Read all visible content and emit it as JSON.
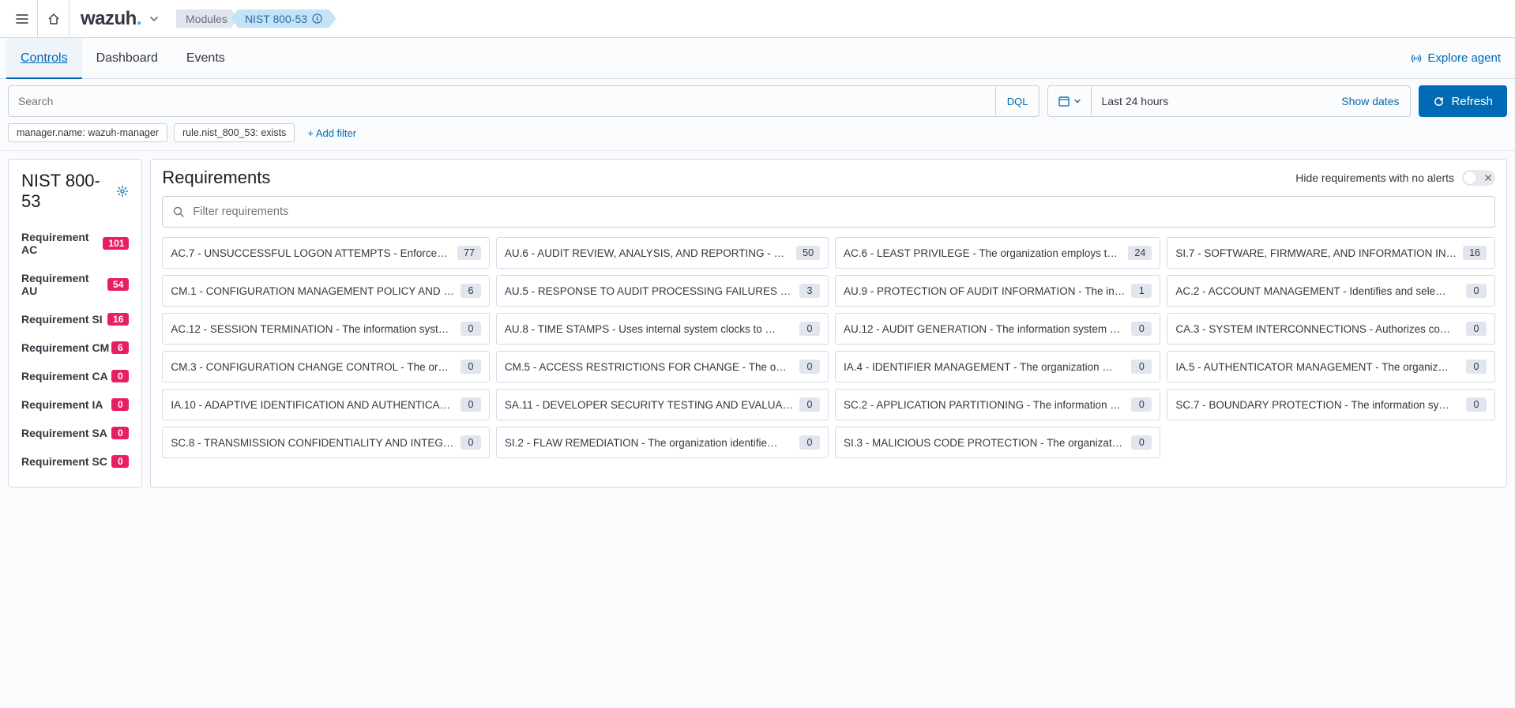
{
  "header": {
    "brand": "wazuh",
    "breadcrumb": {
      "modules": "Modules",
      "current": "NIST 800-53"
    }
  },
  "tabs": {
    "controls": "Controls",
    "dashboard": "Dashboard",
    "events": "Events",
    "explore": "Explore agent"
  },
  "search": {
    "placeholder": "Search",
    "dql": "DQL",
    "time": "Last 24 hours",
    "show_dates": "Show dates",
    "refresh": "Refresh"
  },
  "filters": {
    "f1": "manager.name: wazuh-manager",
    "f2": "rule.nist_800_53: exists",
    "add": "+ Add filter"
  },
  "sidebar": {
    "title": "NIST 800-53",
    "items": [
      {
        "label": "Requirement AC",
        "count": "101"
      },
      {
        "label": "Requirement AU",
        "count": "54"
      },
      {
        "label": "Requirement SI",
        "count": "16"
      },
      {
        "label": "Requirement CM",
        "count": "6"
      },
      {
        "label": "Requirement CA",
        "count": "0"
      },
      {
        "label": "Requirement IA",
        "count": "0"
      },
      {
        "label": "Requirement SA",
        "count": "0"
      },
      {
        "label": "Requirement SC",
        "count": "0"
      }
    ]
  },
  "requirements": {
    "title": "Requirements",
    "hide_label": "Hide requirements with no alerts",
    "filter_placeholder": "Filter requirements",
    "cards": [
      {
        "text": "AC.7 - UNSUCCESSFUL LOGON ATTEMPTS - Enforce…",
        "count": "77"
      },
      {
        "text": "AU.6 - AUDIT REVIEW, ANALYSIS, AND REPORTING - …",
        "count": "50"
      },
      {
        "text": "AC.6 - LEAST PRIVILEGE - The organization employs t…",
        "count": "24"
      },
      {
        "text": "SI.7 - SOFTWARE, FIRMWARE, AND INFORMATION IN…",
        "count": "16"
      },
      {
        "text": "CM.1 - CONFIGURATION MANAGEMENT POLICY AND …",
        "count": "6"
      },
      {
        "text": "AU.5 - RESPONSE TO AUDIT PROCESSING FAILURES …",
        "count": "3"
      },
      {
        "text": "AU.9 - PROTECTION OF AUDIT INFORMATION - The in…",
        "count": "1"
      },
      {
        "text": "AC.2 - ACCOUNT MANAGEMENT - Identifies and sele…",
        "count": "0"
      },
      {
        "text": "AC.12 - SESSION TERMINATION - The information syst…",
        "count": "0"
      },
      {
        "text": "AU.8 - TIME STAMPS - Uses internal system clocks to …",
        "count": "0"
      },
      {
        "text": "AU.12 - AUDIT GENERATION - The information system …",
        "count": "0"
      },
      {
        "text": "CA.3 - SYSTEM INTERCONNECTIONS - Authorizes co…",
        "count": "0"
      },
      {
        "text": "CM.3 - CONFIGURATION CHANGE CONTROL - The or…",
        "count": "0"
      },
      {
        "text": "CM.5 - ACCESS RESTRICTIONS FOR CHANGE - The o…",
        "count": "0"
      },
      {
        "text": "IA.4 - IDENTIFIER MANAGEMENT - The organization …",
        "count": "0"
      },
      {
        "text": "IA.5 - AUTHENTICATOR MANAGEMENT - The organiz…",
        "count": "0"
      },
      {
        "text": "IA.10 - ADAPTIVE IDENTIFICATION AND AUTHENTICA…",
        "count": "0"
      },
      {
        "text": "SA.11 - DEVELOPER SECURITY TESTING AND EVALUA…",
        "count": "0"
      },
      {
        "text": "SC.2 - APPLICATION PARTITIONING - The information …",
        "count": "0"
      },
      {
        "text": "SC.7 - BOUNDARY PROTECTION - The information sy…",
        "count": "0"
      },
      {
        "text": "SC.8 - TRANSMISSION CONFIDENTIALITY AND INTEG…",
        "count": "0"
      },
      {
        "text": "SI.2 - FLAW REMEDIATION - The organization identifie…",
        "count": "0"
      },
      {
        "text": "SI.3 - MALICIOUS CODE PROTECTION - The organizat…",
        "count": "0"
      }
    ]
  }
}
